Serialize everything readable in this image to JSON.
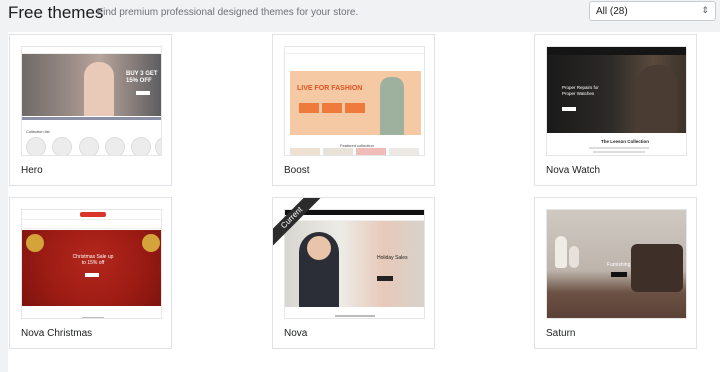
{
  "header": {
    "title": "Free themes",
    "subtitle": "Find premium professional designed themes for your store.",
    "filter_value": "All (28)"
  },
  "themes": [
    {
      "name": "Hero",
      "preview_text": "BUY 3 GET 15% OFF"
    },
    {
      "name": "Boost",
      "preview_text": "LIVE FOR FASHION"
    },
    {
      "name": "Nova Watch",
      "preview_text": "Proper Repairs for Proper Watches",
      "preview_text2": "The Leeson Collection"
    },
    {
      "name": "Nova Christmas",
      "preview_text": "Christmas Sale up to 15% off"
    },
    {
      "name": "Nova",
      "preview_text": "Holiday Sales",
      "badge": "Current"
    },
    {
      "name": "Saturn",
      "preview_text": "Furnishing"
    }
  ],
  "colors": {
    "page_bg": "#f1f2f4",
    "boost_banner": "#f6c9a5",
    "christmas_red": "#9d1c14",
    "watch_dark": "#2d2a27"
  }
}
